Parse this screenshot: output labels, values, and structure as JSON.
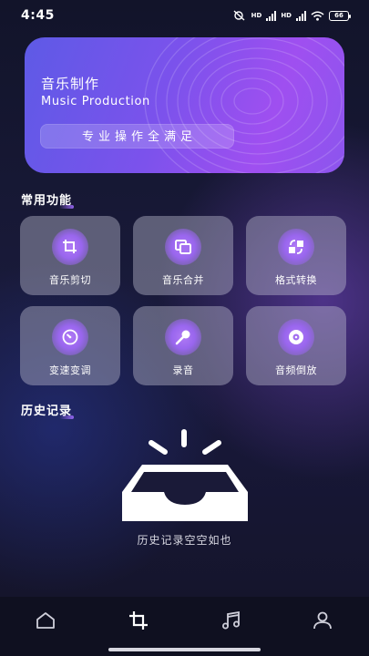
{
  "status_bar": {
    "time": "4:45",
    "network_1": "HD",
    "network_2": "HD",
    "battery": "66"
  },
  "banner": {
    "title": "音乐制作",
    "subtitle": "Music Production",
    "pill": "专业操作全满足"
  },
  "features": {
    "title": "常用功能",
    "items": [
      {
        "label": "音乐剪切",
        "icon": "crop-icon"
      },
      {
        "label": "音乐合并",
        "icon": "merge-icon"
      },
      {
        "label": "格式转换",
        "icon": "convert-icon"
      },
      {
        "label": "变速变调",
        "icon": "speed-dial-icon"
      },
      {
        "label": "录音",
        "icon": "microphone-icon"
      },
      {
        "label": "音频倒放",
        "icon": "reverse-disc-icon"
      }
    ]
  },
  "history": {
    "title": "历史记录",
    "empty_text": "历史记录空空如也"
  },
  "nav": {
    "items": [
      "home-icon",
      "crop-icon",
      "music-note-icon",
      "user-icon"
    ],
    "active": "crop-icon"
  },
  "colors": {
    "accent": "#9966ee",
    "banner_start": "#5e5ae6",
    "banner_end": "#9f4ff0"
  }
}
